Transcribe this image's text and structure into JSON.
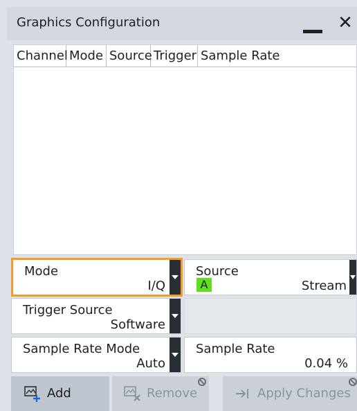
{
  "window": {
    "title": "Graphics Configuration"
  },
  "table": {
    "columns": [
      "Channel",
      "Mode",
      "Source",
      "Trigger",
      "Sample Rate"
    ],
    "rows": []
  },
  "fields": {
    "mode": {
      "label": "Mode",
      "value": "I/Q"
    },
    "source": {
      "label": "Source",
      "badge": "A",
      "value": "Stream"
    },
    "trigger_source": {
      "label": "Trigger Source",
      "value": "Software"
    },
    "sample_rate_mode": {
      "label": "Sample Rate Mode",
      "value": "Auto"
    },
    "sample_rate": {
      "label": "Sample Rate",
      "value": "0.04 %"
    }
  },
  "buttons": {
    "add": "Add",
    "remove": "Remove",
    "apply": "Apply Changes"
  },
  "colors": {
    "focus": "#f39c2a",
    "source_badge": "#5fdf1d"
  }
}
